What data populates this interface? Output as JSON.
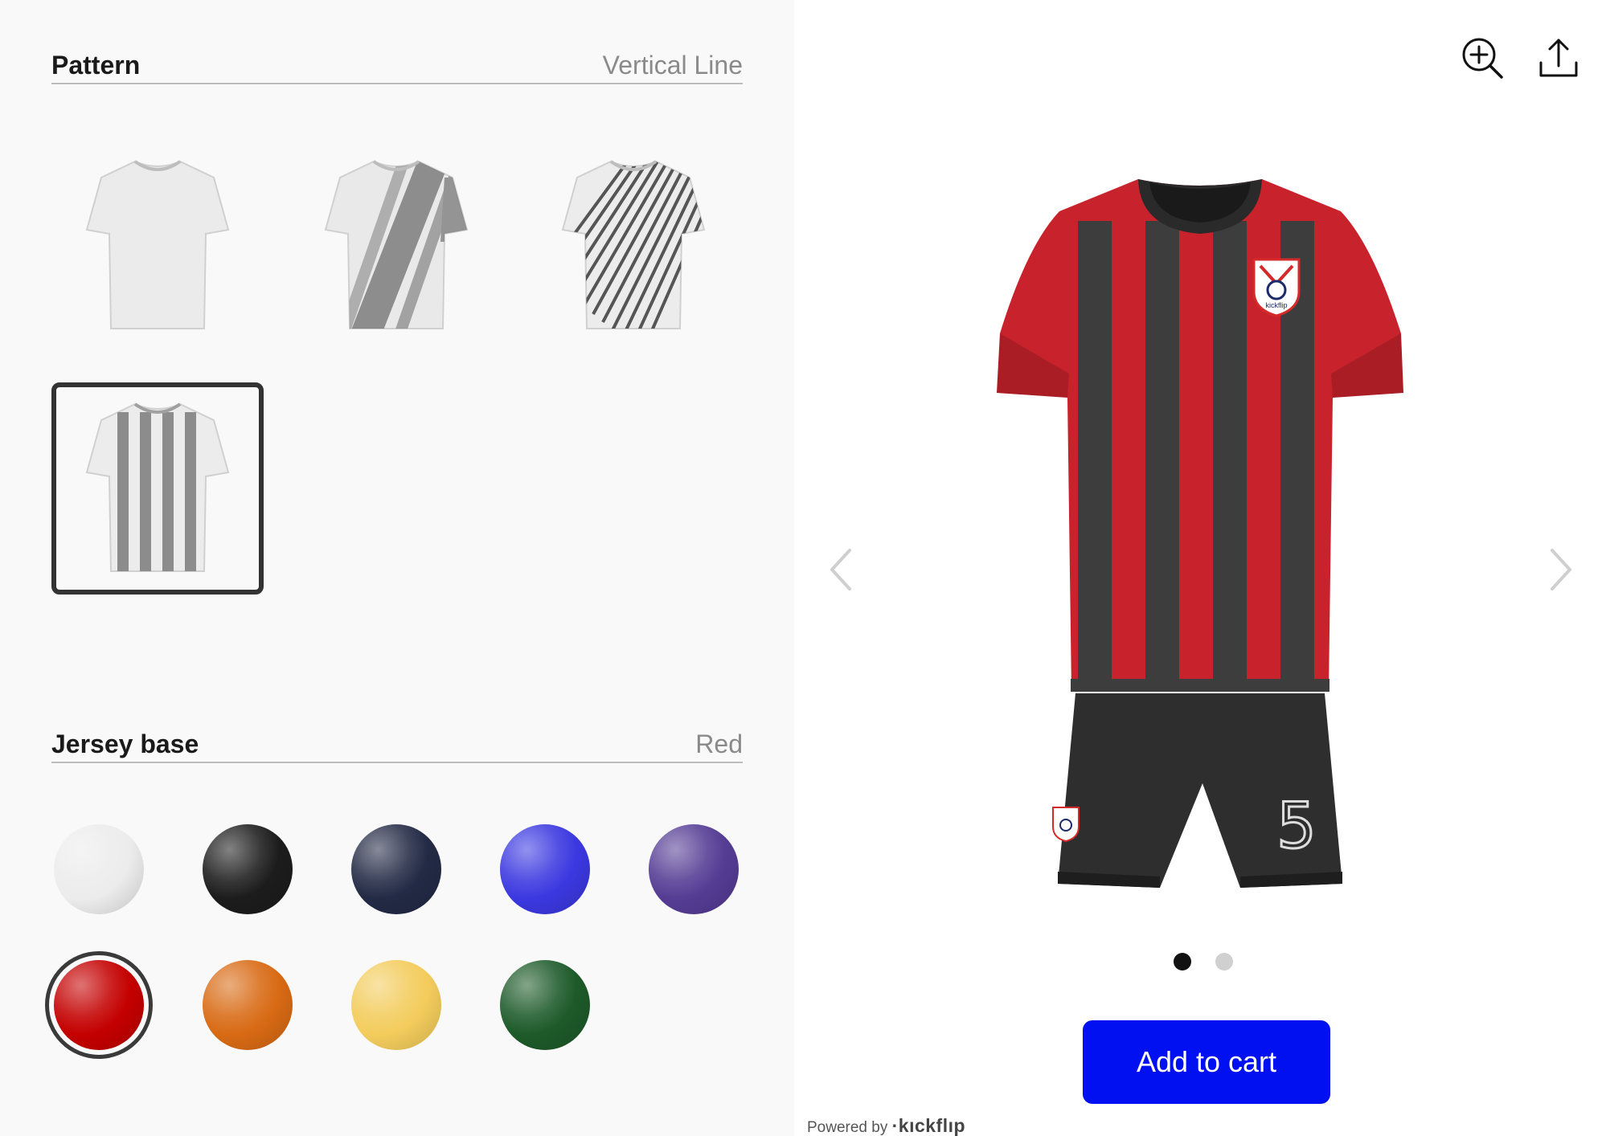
{
  "pattern": {
    "title": "Pattern",
    "selected_value": "Vertical Line",
    "options": [
      {
        "name": "Plain"
      },
      {
        "name": "Diagonal Blur"
      },
      {
        "name": "Diagonal Stripes"
      },
      {
        "name": "Vertical Line",
        "selected": true
      }
    ]
  },
  "jersey_base": {
    "title": "Jersey base",
    "selected_value": "Red",
    "colors": [
      {
        "name": "White",
        "hex": "#ececec"
      },
      {
        "name": "Black",
        "hex": "#1c1c1c"
      },
      {
        "name": "Navy",
        "hex": "#232a45"
      },
      {
        "name": "Blue",
        "hex": "#3b38e0"
      },
      {
        "name": "Purple",
        "hex": "#553c94"
      },
      {
        "name": "Red",
        "hex": "#c40000",
        "selected": true
      },
      {
        "name": "Orange",
        "hex": "#d86a14"
      },
      {
        "name": "Yellow",
        "hex": "#f3cc5c"
      },
      {
        "name": "Green",
        "hex": "#1d5a29"
      }
    ]
  },
  "viewer": {
    "zoom_icon": "zoom-in-icon",
    "share_icon": "share-upload-icon",
    "prev_icon": "chevron-left-icon",
    "next_icon": "chevron-right-icon",
    "jersey_colors": {
      "base": "#c8232c",
      "stripe": "#3d3d3d",
      "shorts": "#2e2e2e"
    },
    "shorts_number": "5",
    "crest_text": "kickflip",
    "pages": 2,
    "current_page": 1
  },
  "cart": {
    "label": "Add to cart",
    "color": "#0010f0"
  },
  "footer": {
    "powered_by": "Powered by",
    "brand": "·kıckflıp"
  }
}
